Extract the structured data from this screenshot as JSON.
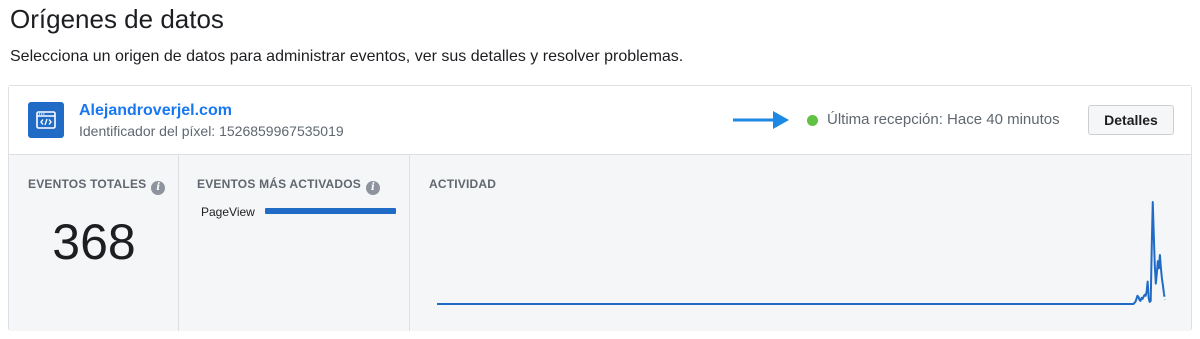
{
  "page": {
    "title": "Orígenes de datos",
    "subtitle": "Selecciona un origen de datos para administrar eventos, ver sus detalles y resolver problemas."
  },
  "source": {
    "icon": "code-window-icon",
    "name": "Alejandroverjel.com",
    "pixel_id": "Identificador del píxel: 1526859967535019",
    "status_color": "#5fc243",
    "status_text": "Última recepción: Hace 40 minutos",
    "details_label": "Detalles"
  },
  "panels": {
    "total_events_label": "EVENTOS TOTALES",
    "total_events_value": "368",
    "top_events_label": "EVENTOS MÁS ACTIVADOS",
    "top_events": [
      {
        "name": "PageView",
        "share": 1.0
      }
    ],
    "activity_label": "ACTIVIDAD"
  },
  "chart_data": {
    "type": "line",
    "title": "ACTIVIDAD",
    "color": "#1f6bc6",
    "grid": false,
    "values": [
      0,
      0,
      0,
      0,
      0,
      0,
      0,
      0,
      0,
      0,
      0,
      0,
      0,
      0,
      0,
      0,
      0,
      0,
      0,
      0,
      0,
      0,
      0,
      0,
      0,
      0,
      0,
      0,
      0,
      0,
      0,
      0,
      0,
      0,
      0,
      0,
      0,
      0,
      0,
      0,
      0,
      0,
      0,
      0,
      0,
      0,
      0,
      0,
      0,
      0,
      0,
      0,
      0,
      0,
      0,
      0,
      0,
      0,
      0,
      0,
      0,
      0,
      0,
      0,
      0,
      0,
      0,
      0,
      0,
      0,
      0,
      0,
      0,
      0,
      0,
      0,
      0,
      0,
      0,
      0,
      0,
      0,
      0,
      0,
      0,
      0,
      0,
      0,
      0,
      0,
      0,
      0,
      0,
      0,
      0,
      0,
      0,
      0,
      0,
      0,
      0,
      0,
      0,
      0,
      0,
      0,
      0,
      0,
      0,
      0,
      0,
      0,
      0,
      0,
      0,
      0,
      0,
      0,
      0,
      0,
      0,
      0,
      0,
      0,
      0,
      0,
      0,
      0,
      0,
      0,
      0,
      0,
      0,
      0,
      0,
      0,
      0,
      0,
      0,
      0,
      0,
      0,
      0,
      0,
      0,
      0,
      0,
      0,
      0,
      0,
      0,
      0,
      0,
      0,
      0,
      0,
      0,
      0,
      0,
      0,
      0,
      0,
      0,
      0,
      0,
      0,
      0,
      0,
      0,
      0,
      0,
      0,
      0,
      0,
      0,
      0,
      0,
      0,
      0,
      0,
      0,
      0,
      0,
      0,
      0,
      0,
      0,
      0,
      0,
      0,
      0,
      0,
      0,
      0,
      0,
      0,
      0,
      0,
      0,
      0,
      0,
      0,
      0,
      0,
      0,
      0,
      0,
      0,
      0,
      0,
      0,
      0,
      0,
      0,
      0,
      0,
      0,
      0,
      0,
      0,
      0,
      0,
      0,
      0,
      0,
      0,
      0,
      0,
      0,
      0,
      0,
      0,
      0,
      0,
      0,
      0,
      0,
      0,
      0,
      0,
      0,
      0,
      0,
      0,
      0,
      0,
      0,
      0,
      0,
      0,
      0,
      0,
      0,
      0,
      0,
      0,
      0,
      0,
      0,
      0,
      0,
      0,
      0,
      0,
      0,
      0,
      0,
      0,
      0,
      0,
      0,
      0,
      0,
      0,
      0,
      0,
      0,
      0,
      0,
      0,
      0,
      0,
      0,
      0,
      0,
      0,
      0,
      0,
      0,
      0,
      0,
      0,
      0,
      0,
      0,
      0,
      0,
      0,
      0,
      0,
      0,
      0,
      0,
      0,
      0,
      0,
      0,
      0,
      0,
      0,
      0,
      0,
      0,
      0,
      0,
      0,
      0,
      0,
      0,
      0,
      0,
      0,
      0,
      0,
      0,
      0,
      0,
      0,
      0,
      0,
      0,
      0,
      0,
      0,
      0,
      0,
      0,
      0,
      0,
      0,
      0,
      0,
      0,
      0,
      0,
      0,
      0,
      0,
      0,
      0,
      0,
      0,
      0,
      0,
      0,
      0,
      0,
      0,
      0,
      0,
      0,
      0,
      0,
      0,
      0,
      0,
      0,
      0,
      0,
      0,
      0,
      0,
      0,
      0,
      0,
      0,
      0,
      0,
      0,
      0,
      0,
      0,
      0,
      0,
      0,
      0,
      0,
      0,
      0,
      0,
      0,
      0,
      0,
      0,
      0,
      0,
      0,
      0,
      0,
      0,
      0,
      0,
      0,
      0,
      0,
      0,
      0,
      0,
      0,
      0,
      0,
      0,
      0,
      0,
      0,
      0,
      0,
      0,
      0,
      0,
      0,
      0,
      0,
      0,
      0,
      0,
      0,
      0,
      0,
      0,
      0,
      0,
      0,
      0,
      0,
      0,
      0,
      0,
      0,
      0,
      0,
      0,
      0,
      0,
      0,
      0,
      0,
      0,
      0,
      0,
      0,
      0,
      0,
      0,
      0,
      0,
      0,
      0,
      0,
      0,
      0,
      0,
      0,
      0,
      0,
      0,
      0,
      0,
      0,
      0,
      0,
      0,
      0,
      0,
      0,
      0,
      0,
      0,
      0,
      0,
      0,
      0,
      0,
      0,
      0,
      0,
      0,
      0,
      0,
      0,
      0,
      0,
      0,
      0,
      0,
      0,
      0,
      0,
      0,
      0,
      0,
      0,
      0,
      0,
      0,
      0,
      0,
      0,
      0,
      0,
      0,
      0,
      0,
      0,
      0,
      0,
      0,
      0,
      0,
      0,
      0,
      0,
      0,
      0,
      0,
      0,
      0,
      0,
      0,
      0,
      0,
      0,
      0,
      0,
      0,
      0,
      0,
      0,
      0,
      0,
      0,
      0,
      0,
      0,
      0,
      0,
      0,
      0,
      0,
      0,
      0,
      0,
      0,
      0,
      0,
      0,
      0,
      0,
      0,
      0,
      0,
      0,
      0,
      0,
      0,
      0,
      0,
      0,
      0,
      0,
      0,
      0,
      0,
      0,
      0,
      0,
      0,
      0,
      0,
      0,
      0,
      0,
      0,
      0,
      0,
      0,
      0,
      0,
      0,
      0,
      0,
      0,
      0,
      0,
      0,
      0,
      0,
      0,
      0,
      0,
      0,
      0,
      0,
      0,
      0,
      0,
      0,
      0,
      0,
      0,
      0,
      0,
      0,
      0,
      0,
      0,
      0,
      0,
      0,
      0,
      0,
      0,
      0,
      0,
      0,
      0,
      0,
      0,
      0,
      0,
      0,
      0,
      0,
      0,
      0,
      0,
      0,
      0,
      0,
      0,
      0,
      0,
      0,
      0,
      0,
      0,
      0,
      0,
      0,
      0,
      0,
      0,
      0,
      0,
      0,
      0,
      0,
      0,
      0,
      0,
      0,
      0,
      0,
      0,
      0,
      0,
      0,
      0,
      0,
      0,
      0,
      0,
      0,
      0,
      0,
      0,
      0,
      0,
      0,
      0,
      0,
      0,
      0,
      1,
      2,
      5,
      8,
      7,
      4,
      3,
      6,
      5,
      7,
      9,
      8,
      12,
      22,
      6,
      2,
      3,
      55,
      100,
      68,
      38,
      20,
      30,
      42,
      35,
      48,
      35,
      25,
      18,
      10,
      4
    ],
    "last_segment_dashed": true
  }
}
